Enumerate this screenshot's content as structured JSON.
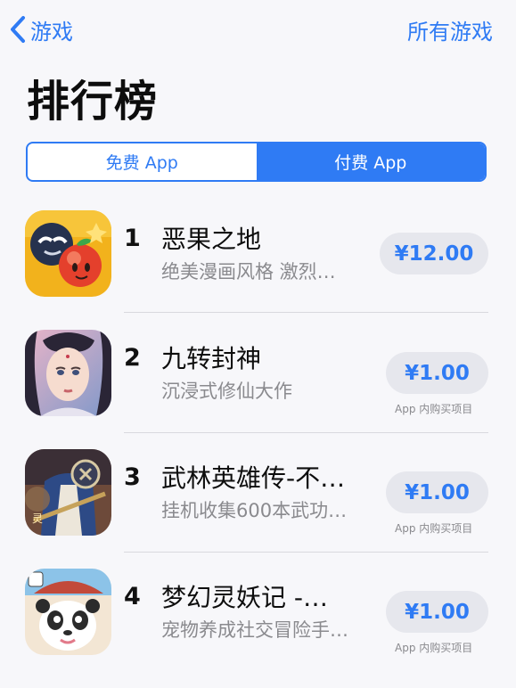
{
  "nav": {
    "back_label": "游戏",
    "right_label": "所有游戏"
  },
  "page": {
    "title": "排行榜"
  },
  "segments": [
    {
      "label": "免费 App",
      "active": false
    },
    {
      "label": "付费 App",
      "active": true
    }
  ],
  "apps": [
    {
      "rank": "1",
      "name": "恶果之地",
      "subtitle": "绝美漫画风格 激烈…",
      "price": "¥12.00",
      "iap": ""
    },
    {
      "rank": "2",
      "name": "九转封神",
      "subtitle": "沉浸式修仙大作",
      "price": "¥1.00",
      "iap": "App 内购买项目"
    },
    {
      "rank": "3",
      "name": "武林英雄传-不…",
      "subtitle": "挂机收集600本武功…",
      "price": "¥1.00",
      "iap": "App 内购买项目"
    },
    {
      "rank": "4",
      "name": "梦幻灵妖记 -…",
      "subtitle": "宠物养成社交冒险手…",
      "price": "¥1.00",
      "iap": "App 内购买项目"
    }
  ],
  "colors": {
    "accent": "#2f7bf4",
    "background": "#f7f7fa",
    "price_button_bg": "#e6e7ed",
    "secondary_text": "#8a8a8e"
  },
  "icons": [
    "chevron-left-icon",
    "app-icon-eguozhidi",
    "app-icon-jiuzhuanfengshen",
    "app-icon-wulinyingxiongzhuan",
    "app-icon-menghuanlingyaoji"
  ]
}
